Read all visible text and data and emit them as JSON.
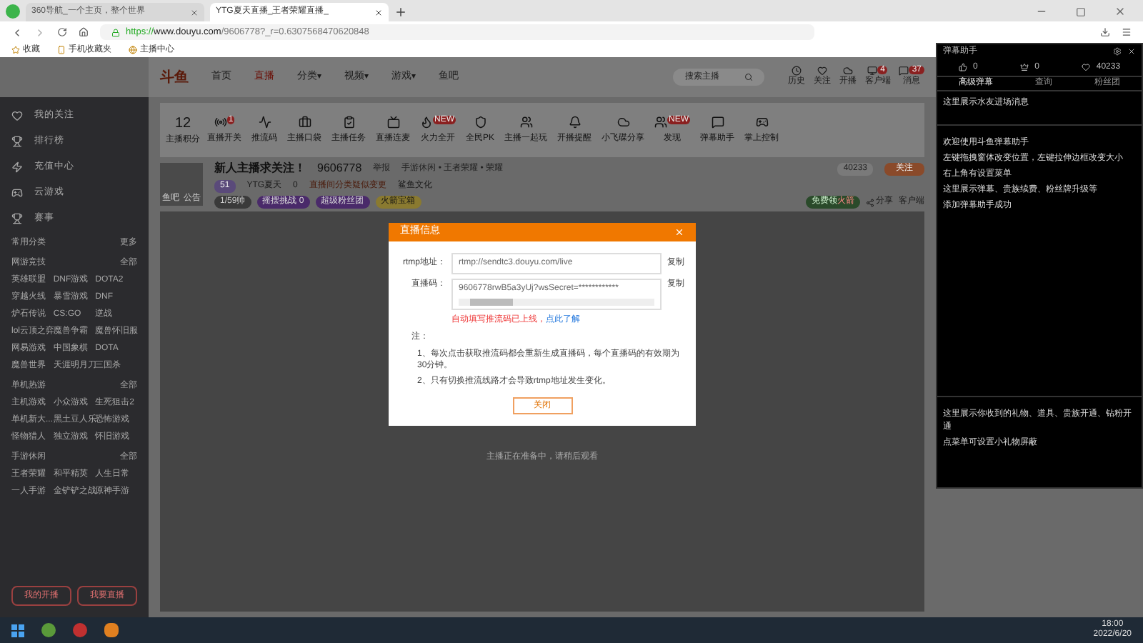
{
  "browser": {
    "tabs": [
      {
        "title": "360导航_一个主页，整个世界",
        "selected": false
      },
      {
        "title": "YTG夏天直播_王者荣耀直播_",
        "selected": true
      }
    ],
    "url_scheme": "https://",
    "url_host": "www.douyu.com",
    "url_path": "/9606778?_r=0.6307568470620848",
    "bookmarks": [
      "收藏",
      "手机收藏夹",
      "主播中心"
    ]
  },
  "site": {
    "logo": "斗鱼",
    "nav": [
      {
        "label": "首页",
        "selected": false
      },
      {
        "label": "直播",
        "selected": true
      },
      {
        "label": "分类",
        "selected": false,
        "caret": "▾"
      },
      {
        "label": "视频",
        "selected": false,
        "caret": "▾"
      },
      {
        "label": "游戏",
        "selected": false,
        "caret": "▾"
      },
      {
        "label": "鱼吧",
        "selected": false
      }
    ],
    "search_placeholder": "搜索主播",
    "header_icons": [
      {
        "label": "历史"
      },
      {
        "label": "关注"
      },
      {
        "label": "开播"
      },
      {
        "label": "客户端",
        "badge": "4"
      },
      {
        "label": "消息",
        "badge": "37"
      }
    ]
  },
  "sidebar": {
    "items": [
      "我的关注",
      "排行榜",
      "充值中心",
      "云游戏",
      "赛事"
    ],
    "sections": [
      {
        "title": "常用分类",
        "more": "更多"
      },
      {
        "title": "网游竞技",
        "more": "全部",
        "games": [
          "英雄联盟",
          "DNF游戏",
          "DOTA2",
          "穿越火线",
          "暴雪游戏",
          "DNF",
          "炉石传说",
          "CS:GO",
          "逆战",
          "lol云顶之弈",
          "魔兽争霸",
          "魔兽怀旧服",
          "网易游戏",
          "中国象棋",
          "DOTA",
          "魔兽世界",
          "天涯明月刀",
          "三国杀"
        ]
      },
      {
        "title": "单机热游",
        "more": "全部",
        "games": [
          "主机游戏",
          "小众游戏",
          "生死狙击2",
          "单机新大...",
          "黑土豆人乐",
          "恐怖游戏",
          "怪物猎人",
          "独立游戏",
          "怀旧游戏"
        ]
      },
      {
        "title": "手游休闲",
        "more": "全部",
        "games": [
          "王者荣耀",
          "和平精英",
          "人生日常",
          "一人手游",
          "金铲铲之战",
          "原神手游"
        ]
      }
    ],
    "buttons": [
      "我的开播",
      "我要直播"
    ]
  },
  "toolbar": {
    "points": "12",
    "points_label": "主播积分",
    "items": [
      {
        "label": "直播开关",
        "badge": "1"
      },
      {
        "label": "推流码"
      },
      {
        "label": "主播口袋"
      },
      {
        "label": "主播任务"
      },
      {
        "label": "直播连麦"
      },
      {
        "label": "火力全开",
        "badge": "NEW"
      },
      {
        "label": "全民PK"
      },
      {
        "label": "主播一起玩"
      },
      {
        "label": "开播提醒"
      },
      {
        "label": "小飞碟分享"
      },
      {
        "label": "发现",
        "badge": "NEW"
      },
      {
        "label": "弹幕助手"
      },
      {
        "label": "掌上控制"
      }
    ]
  },
  "anchor": {
    "title": "新人主播求关注！",
    "room_id": "9606778",
    "report": "举报",
    "category": "手游休闲 • 王者荣耀 • 荣耀",
    "avatar_labels": [
      "鱼吧",
      "公告"
    ],
    "level": "51",
    "name": "YTG夏天",
    "heat": "0",
    "notice": "直播间分类疑似变更",
    "culture": "鲨鱼文化",
    "chips": [
      "1/59帅",
      "摇摆挑战 0",
      "超级粉丝团",
      "火箭宝箱"
    ],
    "free_gift": "免费领",
    "free_gift_hot": "火箭",
    "share": "分享",
    "client": "客户端",
    "followers": "40233",
    "follow": "关注",
    "video_hint": "主播正在准备中，请稍后观看"
  },
  "dialog": {
    "title": "直播信息",
    "rtmp_label": "rtmp地址：",
    "rtmp_value": "rtmp://sendtc3.douyu.com/live",
    "rtmp_copy": "复制",
    "code_label": "直播码：",
    "code_value": "9606778rwB5a3yUj?wsSecret=************",
    "code_copy": "复制",
    "warning": "自动填写推流码已上线，",
    "link": "点此了解",
    "note_title": "注：",
    "notes": [
      "1、每次点击获取推流码都会重新生成直播码，每个直播码的有效期为30分钟。",
      "2、只有切换推流线路才会导致rtmp地址发生变化。"
    ],
    "close": "关闭"
  },
  "assistant": {
    "title": "弹幕助手",
    "stats": [
      "0",
      "0",
      "40233"
    ],
    "tabs": [
      {
        "label": "高级弹幕",
        "selected": true
      },
      {
        "label": "查询",
        "selected": false
      },
      {
        "label": "粉丝团",
        "selected": false
      }
    ],
    "top_message": "这里展示水友进场消息",
    "messages": [
      "欢迎使用斗鱼弹幕助手",
      "左键拖拽窗体改变位置，左键拉伸边框改变大小",
      "右上角有设置菜单",
      "这里展示弹幕、贵族续费、粉丝牌升级等",
      "添加弹幕助手成功"
    ],
    "bottom_messages": [
      "这里展示你收到的礼物、道具、贵族开通、钻粉开通",
      "点菜单可设置小礼物屏蔽"
    ]
  },
  "taskbar": {
    "time": "18:00",
    "date": "2022/6/20"
  }
}
